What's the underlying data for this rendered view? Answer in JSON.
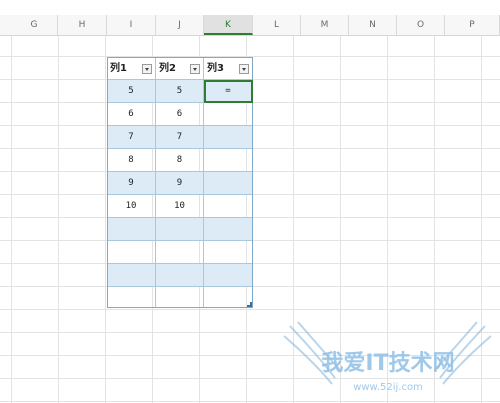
{
  "column_headers": [
    "G",
    "H",
    "I",
    "J",
    "K",
    "L",
    "M",
    "N",
    "O",
    "P"
  ],
  "active_column": "K",
  "table": {
    "headers": [
      "列1",
      "列2",
      "列3"
    ],
    "rows": [
      [
        "5",
        "5",
        "="
      ],
      [
        "6",
        "6",
        ""
      ],
      [
        "7",
        "7",
        ""
      ],
      [
        "8",
        "8",
        ""
      ],
      [
        "9",
        "9",
        ""
      ],
      [
        "10",
        "10",
        ""
      ],
      [
        "",
        "",
        ""
      ],
      [
        "",
        "",
        ""
      ],
      [
        "",
        "",
        ""
      ],
      [
        "",
        "",
        ""
      ]
    ]
  },
  "watermark": {
    "text": "我爱IT技术网",
    "url": "www.52ij.com"
  }
}
